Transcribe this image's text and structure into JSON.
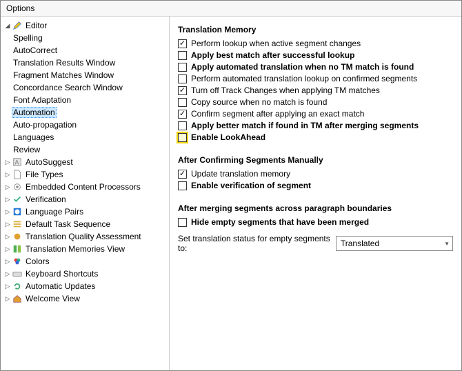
{
  "window": {
    "title": "Options"
  },
  "sidebar": {
    "editor": {
      "label": "Editor",
      "children": {
        "spelling": "Spelling",
        "autocorrect": "AutoCorrect",
        "translation_results_window": "Translation Results Window",
        "fragment_matches_window": "Fragment Matches Window",
        "concordance_search_window": "Concordance Search Window",
        "font_adaptation": "Font Adaptation",
        "automation": "Automation",
        "auto_propagation": "Auto-propagation",
        "languages": "Languages",
        "review": "Review"
      }
    },
    "autosuggest": "AutoSuggest",
    "file_types": "File Types",
    "embedded_content_processors": "Embedded Content Processors",
    "verification": "Verification",
    "language_pairs": "Language Pairs",
    "default_task_sequence": "Default Task Sequence",
    "translation_quality_assessment": "Translation Quality Assessment",
    "translation_memories_view": "Translation Memories View",
    "colors": "Colors",
    "keyboard_shortcuts": "Keyboard Shortcuts",
    "automatic_updates": "Automatic Updates",
    "welcome_view": "Welcome View"
  },
  "main": {
    "group1": {
      "title": "Translation Memory",
      "opt1": "Perform lookup when active segment changes",
      "opt2": "Apply best match after successful lookup",
      "opt3": "Apply automated translation when no TM match is found",
      "opt4": "Perform automated translation lookup on confirmed segments",
      "opt5": "Turn off Track Changes when applying TM matches",
      "opt6": "Copy source when no match is found",
      "opt7": "Confirm segment after applying an exact match",
      "opt8": "Apply better match if found in TM after merging segments",
      "opt9": "Enable LookAhead"
    },
    "group2": {
      "title": "After Confirming Segments Manually",
      "opt1": "Update translation memory",
      "opt2": "Enable verification of segment"
    },
    "group3": {
      "title": "After merging segments across paragraph boundaries",
      "opt1": "Hide empty segments that have been merged"
    },
    "statusrow": {
      "label": "Set translation status for empty segments to:",
      "value": "Translated"
    }
  }
}
